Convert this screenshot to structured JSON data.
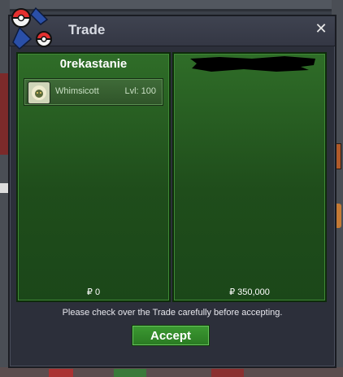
{
  "window": {
    "title": "Trade",
    "close_label": "✕"
  },
  "left_panel": {
    "trader_name": "0rekastanie",
    "items": [
      {
        "name": "Whimsicott",
        "level": "Lvl: 100",
        "icon": "whimsicott-icon"
      }
    ],
    "money": "₽ 0"
  },
  "right_panel": {
    "trader_name_redacted": true,
    "money": "₽ 350,000"
  },
  "footer": {
    "message": "Please check over the Trade carefully before accepting.",
    "accept_label": "Accept"
  },
  "colors": {
    "panel_green": "#2f6d28",
    "window_bg": "#2c2f3a",
    "accept_green": "#3c9a32"
  }
}
